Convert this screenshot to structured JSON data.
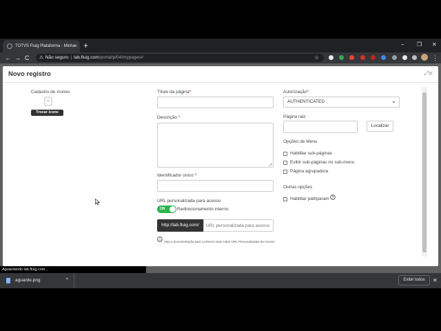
{
  "browser": {
    "tab_title": "TOTVS Fluig Plataforma - Minha",
    "tab_close": "×",
    "new_tab": "+",
    "win_min": "–",
    "win_max": "❐",
    "win_close": "✕",
    "back": "←",
    "forward": "→",
    "reload": "C",
    "security_label": "Não seguro",
    "url_host": "lab.fluig.com",
    "url_path": "/portal/p/04/mypages#",
    "bookmark": "☆",
    "menu": "⋮"
  },
  "modal": {
    "title": "Novo registro",
    "header_icons": "⤢✕",
    "icon_section_label": "Cadastro de ícones",
    "change_icon_button": "Trocar ícone",
    "page_title_label": "Título da página",
    "description_label": "Descrição",
    "unique_id_label": "Identificador único",
    "required_mark": "*",
    "custom_url_label": "URL personalizada para acesso",
    "toggle_state": "ON",
    "internal_redirect_label": "Redirecionamento interno",
    "url_prefix": "http://lab.fluig.com/",
    "url_placeholder": "URL personalizada para acesso",
    "help_text": "Veja a documentação para conhecer mais sobre URL Personalizadas de Acesso",
    "help_icon": "i",
    "authorization_label": "Autorização",
    "authorization_value": "AUTHENTICATED",
    "chevron": "⌄",
    "root_page_label": "Página raiz",
    "locate_button": "Localizar",
    "menu_options_label": "Opções de Menu",
    "menu_options": [
      "Habilitar sub-páginas",
      "Exibir sub-páginas no sub-menu",
      "Página agrupadora"
    ],
    "other_options_label": "Outras opções",
    "pathparam_label": "Habilitar pathparam",
    "pathparam_help": "?"
  },
  "status_bar": {
    "text": "Aguardando lab.fluig.com..."
  },
  "downloads": {
    "file_name": "aguarde.png",
    "chevron": "^",
    "show_all": "Exibir todos",
    "close": "✕"
  },
  "colors": {
    "toggle_on": "#2db350",
    "required": "#cc0000",
    "button_dark": "#333333"
  }
}
